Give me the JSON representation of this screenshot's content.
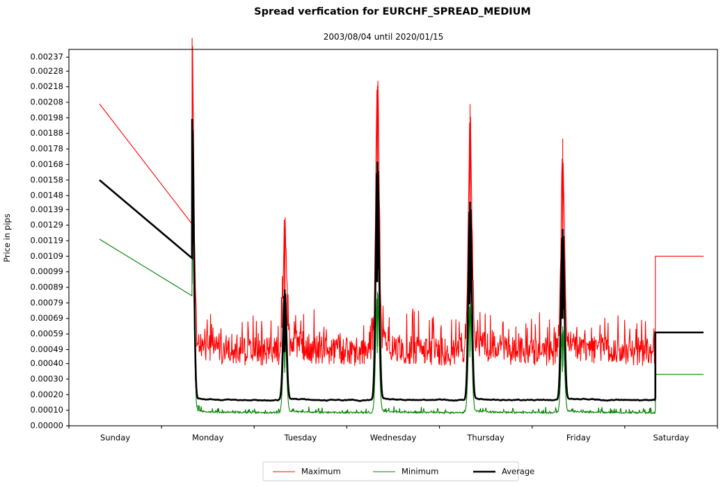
{
  "chart_data": {
    "type": "line",
    "title": "Spread verfication for EURCHF_SPREAD_MEDIUM",
    "subtitle": "2003/08/04 until 2020/01/15",
    "xlabel": "",
    "ylabel": "Price in pips",
    "grid": false,
    "legend_position": "below-center",
    "xlim": [
      0,
      7
    ],
    "ylim": [
      0.0,
      0.00242
    ],
    "x_tick_labels": [
      "Sunday",
      "Monday",
      "Tuesday",
      "Wednesday",
      "Thursday",
      "Friday",
      "Saturday"
    ],
    "x_tick_positions": [
      0.5,
      1.5,
      2.5,
      3.5,
      4.5,
      5.5,
      6.5
    ],
    "x_boundary_ticks": [
      0,
      1,
      2,
      3,
      4,
      5,
      6,
      7
    ],
    "y_tick_labels": [
      "0.00000",
      "0.00010",
      "0.00020",
      "0.00030",
      "0.00040",
      "0.00049",
      "0.00059",
      "0.00069",
      "0.00079",
      "0.00089",
      "0.00099",
      "0.00109",
      "0.00119",
      "0.00129",
      "0.00139",
      "0.00148",
      "0.00158",
      "0.00168",
      "0.00178",
      "0.00188",
      "0.00198",
      "0.00208",
      "0.00218",
      "0.00228",
      "0.00237"
    ],
    "y_tick_values": [
      0.0,
      0.0001,
      0.0002,
      0.0003,
      0.0004,
      0.00049,
      0.00059,
      0.00069,
      0.00079,
      0.00089,
      0.00099,
      0.00109,
      0.00119,
      0.00129,
      0.00139,
      0.00148,
      0.00158,
      0.00168,
      0.00178,
      0.00188,
      0.00198,
      0.00208,
      0.00218,
      0.00228,
      0.00237
    ],
    "series": [
      {
        "name": "Maximum",
        "color": "#FF0000",
        "width": 1.1,
        "weekend_level_sunday": 0.00207,
        "weekend_level_saturday": 0.00109,
        "weekend_start_x": 0.33,
        "weekend_end_x": 6.85,
        "session_start_x": 1.33,
        "session_end_x": 6.33,
        "band_low": 0.00032,
        "band_high": 0.00066,
        "band_mean": 0.00045,
        "rollover_peaks": [
          {
            "x": 1.33,
            "value": 0.00236
          },
          {
            "x": 2.33,
            "value": 0.00124
          },
          {
            "x": 3.33,
            "value": 0.00213
          },
          {
            "x": 4.33,
            "value": 0.00189
          },
          {
            "x": 5.33,
            "value": 0.0017
          }
        ]
      },
      {
        "name": "Minimum",
        "color": "#008000",
        "width": 1.1,
        "weekend_level_sunday": 0.0012,
        "weekend_level_saturday": 0.00033,
        "weekend_start_x": 0.33,
        "weekend_end_x": 6.85,
        "session_start_x": 1.33,
        "session_end_x": 6.33,
        "band_low": 7e-05,
        "band_high": 0.00013,
        "band_mean": 9e-05,
        "rollover_peaks": [
          {
            "x": 1.33,
            "value": 0.00152
          },
          {
            "x": 2.33,
            "value": 0.00062
          },
          {
            "x": 3.33,
            "value": 0.00085
          },
          {
            "x": 4.33,
            "value": 0.0008
          },
          {
            "x": 5.33,
            "value": 0.00063
          }
        ]
      },
      {
        "name": "Average",
        "color": "#000000",
        "width": 2.6,
        "weekend_level_sunday": 0.00158,
        "weekend_level_saturday": 0.0006,
        "weekend_start_x": 0.33,
        "weekend_end_x": 6.85,
        "session_start_x": 1.33,
        "session_end_x": 6.33,
        "band_low": 0.00013,
        "band_high": 0.00019,
        "band_mean": 0.00016,
        "rollover_peaks": [
          {
            "x": 1.33,
            "value": 0.00196
          },
          {
            "x": 2.33,
            "value": 0.00086
          },
          {
            "x": 3.33,
            "value": 0.00168
          },
          {
            "x": 4.33,
            "value": 0.00142
          },
          {
            "x": 5.33,
            "value": 0.00125
          }
        ]
      }
    ]
  },
  "legend": {
    "entries": [
      {
        "label": "Maximum",
        "color": "#FF0000",
        "width": 1.1
      },
      {
        "label": "Minimum",
        "color": "#008000",
        "width": 1.1
      },
      {
        "label": "Average",
        "color": "#000000",
        "width": 2.6
      }
    ]
  }
}
